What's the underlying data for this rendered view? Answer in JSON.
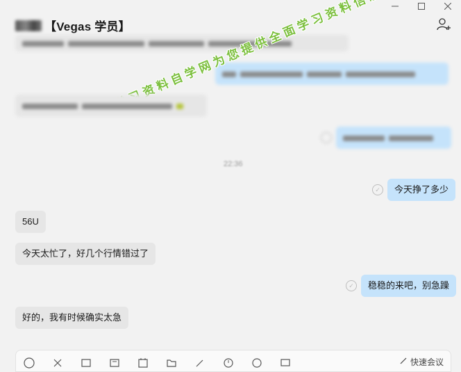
{
  "window": {
    "minimize_icon": "minimize-icon",
    "maximize_icon": "maximize-icon",
    "close_icon": "close-icon"
  },
  "header": {
    "title": "【Vegas 学员】",
    "add_member_icon": "add-person-icon"
  },
  "watermark": "学习资料自学网为您提供全面学习资料信息资源",
  "messages": [
    {
      "side": "left",
      "redacted": true
    },
    {
      "side": "right",
      "redacted": true
    },
    {
      "side": "left",
      "redacted": true
    },
    {
      "side": "right",
      "redacted": true
    },
    {
      "side": "right",
      "text": "今天挣了多少"
    },
    {
      "side": "left",
      "text": "56U"
    },
    {
      "side": "left",
      "text": "今天太忙了，好几个行情错过了"
    },
    {
      "side": "right",
      "text": "稳稳的来吧，别急躁"
    },
    {
      "side": "left",
      "text": "好的，我有时候确实太急"
    }
  ],
  "timestamp": "22:36",
  "toolbar": {
    "icons": [
      "emoji-icon",
      "scissors-icon",
      "folder-icon",
      "image-icon",
      "calendar-icon",
      "file-icon",
      "pen-icon",
      "history-icon",
      "voice-icon",
      "screen-icon"
    ],
    "summary_label": "快速会议"
  },
  "colors": {
    "background": "#f2f2f2",
    "bubble_left": "#e6e6e6",
    "bubble_right": "#c5e3fb",
    "watermark": "#7bbf3c"
  }
}
